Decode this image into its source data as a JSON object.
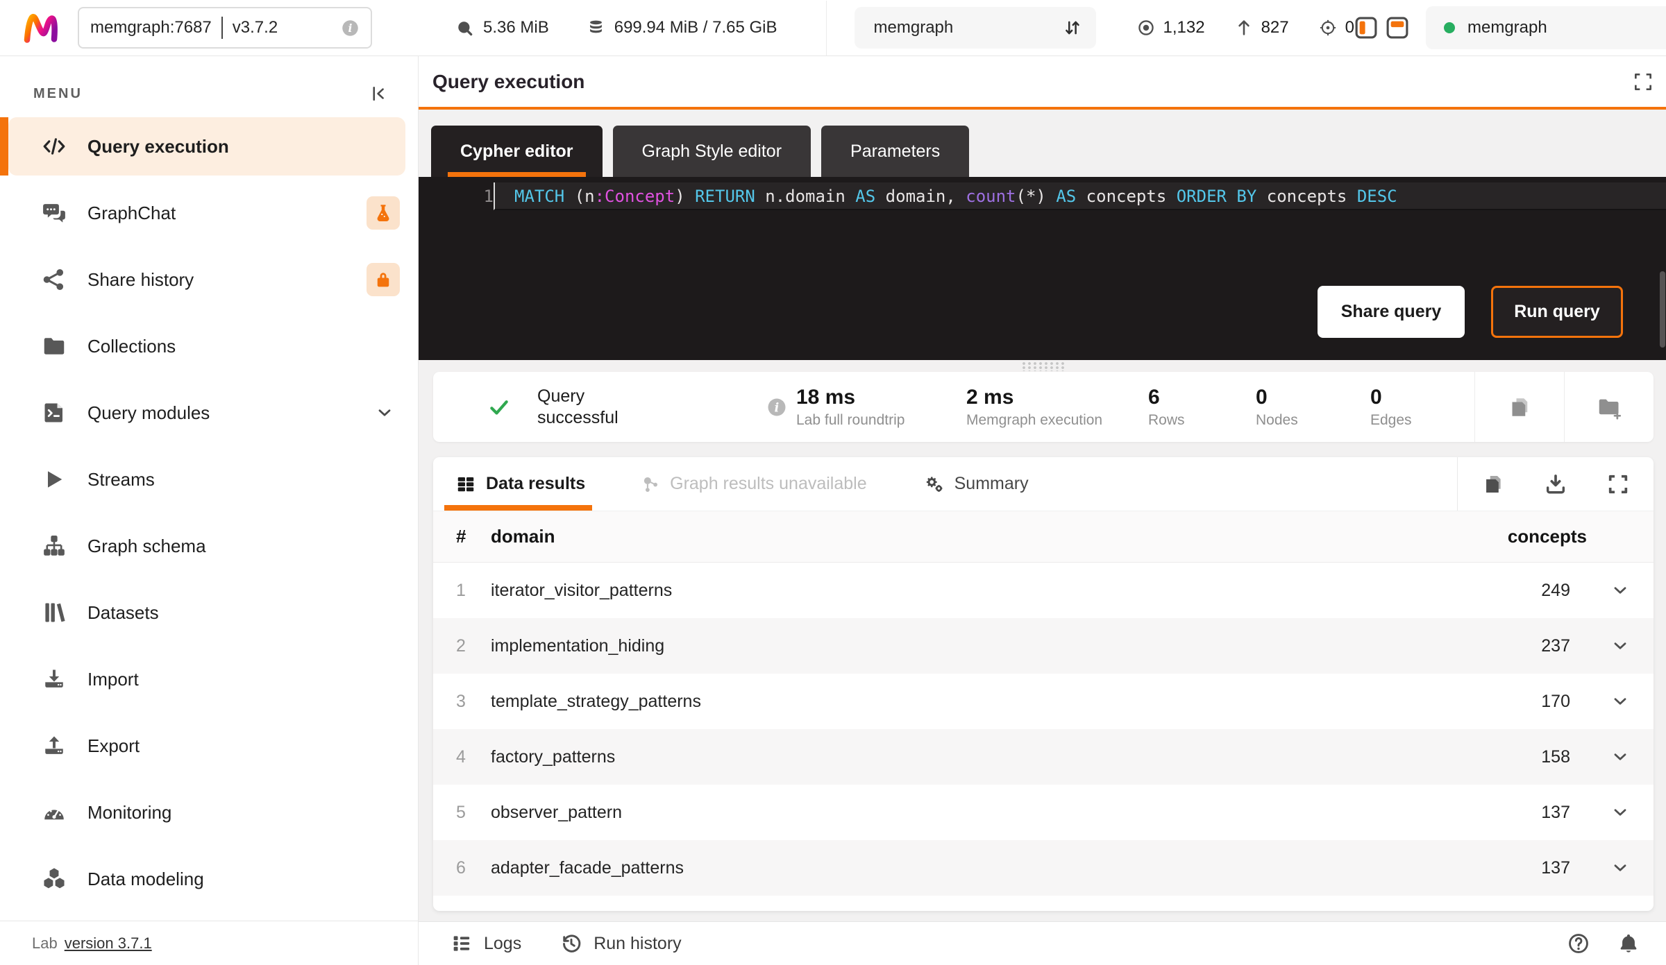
{
  "colors": {
    "accent": "#f4730c",
    "success_green": "#2fa84f",
    "connection_green": "#27ae60"
  },
  "topbar": {
    "endpoint": "memgraph:7687",
    "version": "v3.7.2",
    "storage_used": "5.36 MiB",
    "memory_usage": "699.94 MiB / 7.65 GiB",
    "database_name": "memgraph",
    "node_count": "1,132",
    "edge_count": "827",
    "label_count": "0",
    "connection_name": "memgraph"
  },
  "sidebar": {
    "menu_title": "MENU",
    "items": [
      {
        "id": "query-execution",
        "label": "Query execution",
        "icon": "code",
        "active": true
      },
      {
        "id": "graphchat",
        "label": "GraphChat",
        "icon": "chat",
        "badge": "flask"
      },
      {
        "id": "share-history",
        "label": "Share history",
        "icon": "share",
        "badge": "lock"
      },
      {
        "id": "collections",
        "label": "Collections",
        "icon": "folder"
      },
      {
        "id": "query-modules",
        "label": "Query modules",
        "icon": "terminal",
        "chevron": true
      },
      {
        "id": "streams",
        "label": "Streams",
        "icon": "play"
      },
      {
        "id": "graph-schema",
        "label": "Graph schema",
        "icon": "schema"
      },
      {
        "id": "datasets",
        "label": "Datasets",
        "icon": "books"
      },
      {
        "id": "import",
        "label": "Import",
        "icon": "import"
      },
      {
        "id": "export",
        "label": "Export",
        "icon": "export"
      },
      {
        "id": "monitoring",
        "label": "Monitoring",
        "icon": "gauge"
      },
      {
        "id": "data-modeling",
        "label": "Data modeling",
        "icon": "cubes"
      }
    ],
    "footer_label": "Lab",
    "footer_version": "version 3.7.1"
  },
  "editor": {
    "title": "Query execution",
    "tabs": [
      {
        "label": "Cypher editor",
        "active": true
      },
      {
        "label": "Graph Style editor",
        "active": false
      },
      {
        "label": "Parameters",
        "active": false
      }
    ],
    "line_number": "1",
    "query_text": "MATCH (n:Concept) RETURN n.domain AS domain, count(*) AS concepts ORDER BY concepts DESC",
    "tokens": [
      {
        "text": "MATCH",
        "type": "kw"
      },
      {
        "text": " (n",
        "type": "pl"
      },
      {
        "text": ":Concept",
        "type": "lb"
      },
      {
        "text": ")",
        "type": "pl"
      },
      {
        "text": " RETURN",
        "type": "kw"
      },
      {
        "text": " n.domain",
        "type": "pl"
      },
      {
        "text": " AS",
        "type": "kw"
      },
      {
        "text": " domain,",
        "type": "pl"
      },
      {
        "text": " count",
        "type": "fn"
      },
      {
        "text": "(*)",
        "type": "pl"
      },
      {
        "text": " AS",
        "type": "kw"
      },
      {
        "text": " concepts",
        "type": "pl"
      },
      {
        "text": " ORDER BY",
        "type": "kw"
      },
      {
        "text": " concepts",
        "type": "pl"
      },
      {
        "text": " DESC",
        "type": "kw"
      }
    ],
    "share_button": "Share query",
    "run_button": "Run query"
  },
  "status": {
    "success_line1": "Query",
    "success_line2": "successful",
    "metrics": [
      {
        "value": "18 ms",
        "label": "Lab full roundtrip"
      },
      {
        "value": "2 ms",
        "label": "Memgraph execution"
      },
      {
        "value": "6",
        "label": "Rows"
      },
      {
        "value": "0",
        "label": "Nodes"
      },
      {
        "value": "0",
        "label": "Edges"
      }
    ]
  },
  "results": {
    "tabs": [
      {
        "label": "Data results",
        "icon": "table",
        "state": "active"
      },
      {
        "label": "Graph results unavailable",
        "icon": "graph",
        "state": "disabled"
      },
      {
        "label": "Summary",
        "icon": "gears",
        "state": "normal"
      }
    ],
    "columns": {
      "num": "#",
      "domain": "domain",
      "concepts": "concepts"
    },
    "rows": [
      {
        "num": "1",
        "domain": "iterator_visitor_patterns",
        "concepts": "249"
      },
      {
        "num": "2",
        "domain": "implementation_hiding",
        "concepts": "237"
      },
      {
        "num": "3",
        "domain": "template_strategy_patterns",
        "concepts": "170"
      },
      {
        "num": "4",
        "domain": "factory_patterns",
        "concepts": "158"
      },
      {
        "num": "5",
        "domain": "observer_pattern",
        "concepts": "137"
      },
      {
        "num": "6",
        "domain": "adapter_facade_patterns",
        "concepts": "137"
      }
    ]
  },
  "footer": {
    "logs": "Logs",
    "run_history": "Run history"
  }
}
